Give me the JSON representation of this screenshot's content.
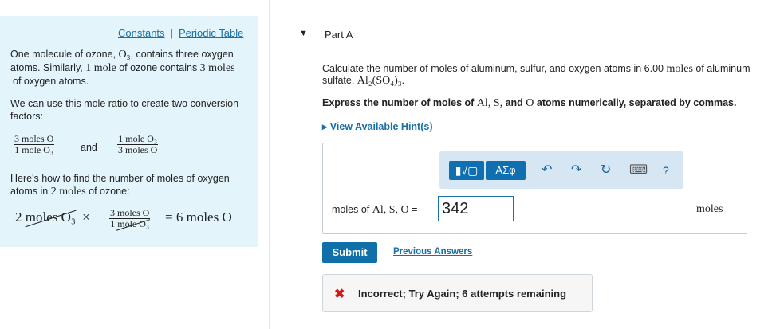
{
  "sidebar": {
    "links": {
      "constants": "Constants",
      "separator": "|",
      "periodic_table": "Periodic Table"
    },
    "p1": {
      "a": "One molecule of ozone, ",
      "ozone": "O₃",
      "b": ", contains three oxygen",
      "c": "atoms. Similarly, ",
      "one_mole": "1 mole",
      "d": " of ozone contains ",
      "three_moles": "3 moles",
      "e": "of oxygen atoms."
    },
    "p2": {
      "line1": "We can use this mole ratio to create two conversion",
      "line2": "factors:"
    },
    "factor1": {
      "num": "3 moles O",
      "den": "1 mole O₃"
    },
    "and": "and",
    "factor2": {
      "num": "1 mole O₃",
      "den": "3 moles O"
    },
    "p3": {
      "line1": "Here's how to find the number of moles of oxygen",
      "line2a": "atoms in ",
      "two_moles": "2 moles",
      "line2b": " of ozone:"
    },
    "equation": {
      "start_num": "2",
      "start_unit": "moles O₃",
      "times": "×",
      "frac_num": "3 moles O",
      "frac_den_num": "1",
      "frac_den_unit": "mole O₃",
      "equals": "=",
      "result": "6 moles O"
    }
  },
  "part": {
    "arrow": "▼",
    "title": "Part A"
  },
  "question": {
    "a": "Calculate the number of moles of aluminum, sulfur, and oxygen atoms in 6.00 ",
    "moles": "moles",
    "b": " of aluminum",
    "c": "sulfate, ",
    "formula": "Al₂(SO₄)₃",
    "d": "."
  },
  "instruction": {
    "a": "Express the number of moles of ",
    "species": "Al, S, ",
    "and": "and ",
    "o": "O",
    "b": " atoms numerically, separated by commas."
  },
  "hint": "▸ View Available Hint(s)",
  "toolbar": {
    "math_btn": "▮√▢",
    "greek_btn": "ΑΣφ",
    "undo_icon": "↶",
    "redo_icon": "↷",
    "reset_icon": "↻",
    "keyboard_icon": "⌨",
    "help_icon": "?"
  },
  "answer": {
    "label_a": "moles of ",
    "label_species": "Al, S, O",
    "label_eq": " =",
    "value": "342",
    "units": "moles"
  },
  "submit": "Submit",
  "previous_answers": "Previous Answers",
  "feedback": {
    "icon": "✖",
    "text": "Incorrect; Try Again; 6 attempts remaining"
  },
  "colors": {
    "sidebar_bg": "#e3f5fb",
    "link": "#1a6fa6",
    "button": "#0f6fa8",
    "error": "#d11a1a"
  }
}
